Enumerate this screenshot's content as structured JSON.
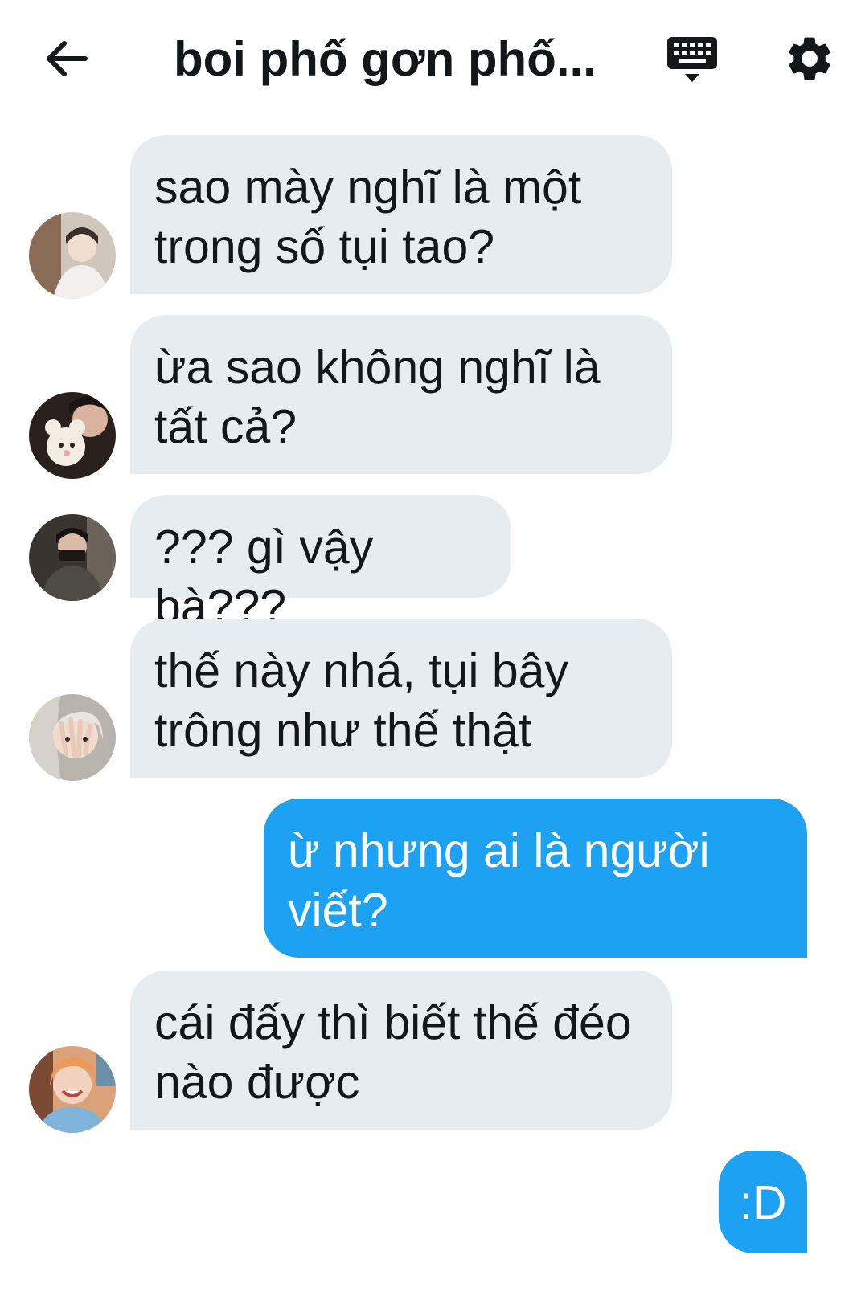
{
  "header": {
    "title": "boi phố gơn phố...",
    "back_icon": "arrow-left-icon",
    "keyboard_icon": "keyboard-icon",
    "settings_icon": "gear-icon"
  },
  "messages": [
    {
      "direction": "incoming",
      "avatar": "avatar-1",
      "text": "sao mày nghĩ là một trong số tụi tao?"
    },
    {
      "direction": "incoming",
      "avatar": "avatar-2",
      "text": "ừa sao không nghĩ là tất cả?"
    },
    {
      "direction": "incoming",
      "avatar": "avatar-3",
      "text": "??? gì vậy bà???"
    },
    {
      "direction": "incoming",
      "avatar": "avatar-4",
      "text": "thế này nhá, tụi bây trông như thế thật"
    },
    {
      "direction": "outgoing",
      "text": "ừ nhưng ai là người viết?"
    },
    {
      "direction": "incoming",
      "avatar": "avatar-5",
      "text": "cái đấy thì biết thế đéo nào được"
    },
    {
      "direction": "outgoing",
      "text": ":D"
    }
  ],
  "colors": {
    "incoming_bubble": "#e6ecf0",
    "outgoing_bubble": "#1da1f2",
    "text": "#14171a",
    "background": "#ffffff"
  }
}
